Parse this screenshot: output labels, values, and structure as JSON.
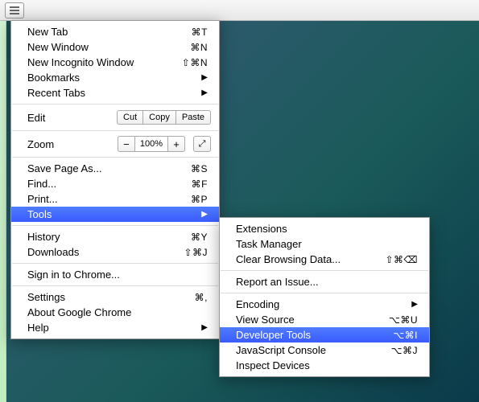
{
  "hamburger_icon": "menu",
  "main_menu": {
    "new_tab": {
      "label": "New Tab",
      "shortcut": "⌘T"
    },
    "new_window": {
      "label": "New Window",
      "shortcut": "⌘N"
    },
    "new_incognito": {
      "label": "New Incognito Window",
      "shortcut": "⇧⌘N"
    },
    "bookmarks": {
      "label": "Bookmarks"
    },
    "recent_tabs": {
      "label": "Recent Tabs"
    },
    "edit": {
      "label": "Edit",
      "cut": "Cut",
      "copy": "Copy",
      "paste": "Paste"
    },
    "zoom": {
      "label": "Zoom",
      "minus": "−",
      "value": "100%",
      "plus": "+",
      "fullscreen": "⤢"
    },
    "save_page": {
      "label": "Save Page As...",
      "shortcut": "⌘S"
    },
    "find": {
      "label": "Find...",
      "shortcut": "⌘F"
    },
    "print": {
      "label": "Print...",
      "shortcut": "⌘P"
    },
    "tools": {
      "label": "Tools"
    },
    "history": {
      "label": "History",
      "shortcut": "⌘Y"
    },
    "downloads": {
      "label": "Downloads",
      "shortcut": "⇧⌘J"
    },
    "signin": {
      "label": "Sign in to Chrome..."
    },
    "settings": {
      "label": "Settings",
      "shortcut": "⌘,"
    },
    "about": {
      "label": "About Google Chrome"
    },
    "help": {
      "label": "Help"
    }
  },
  "tools_submenu": {
    "extensions": {
      "label": "Extensions"
    },
    "task_manager": {
      "label": "Task Manager"
    },
    "clear_browsing": {
      "label": "Clear Browsing Data...",
      "shortcut": "⇧⌘⌫"
    },
    "report_issue": {
      "label": "Report an Issue..."
    },
    "encoding": {
      "label": "Encoding"
    },
    "view_source": {
      "label": "View Source",
      "shortcut": "⌥⌘U"
    },
    "developer_tools": {
      "label": "Developer Tools",
      "shortcut": "⌥⌘I"
    },
    "js_console": {
      "label": "JavaScript Console",
      "shortcut": "⌥⌘J"
    },
    "inspect_devices": {
      "label": "Inspect Devices"
    }
  }
}
